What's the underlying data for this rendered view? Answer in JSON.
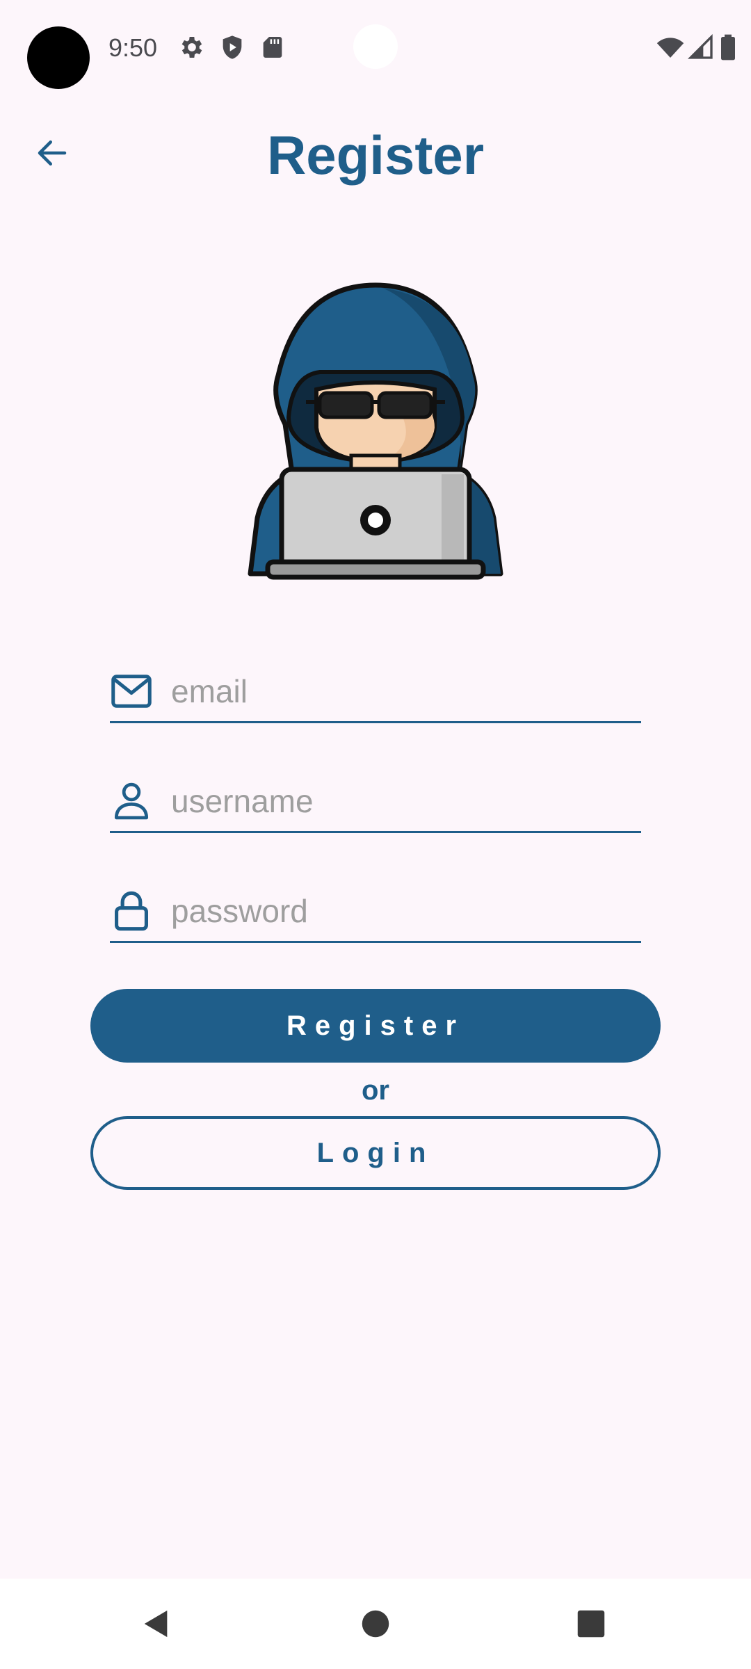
{
  "status_bar": {
    "time": "9:50",
    "left_icons": [
      "gear-icon",
      "shield-play-icon",
      "sd-card-icon"
    ],
    "right_icons": [
      "wifi-icon",
      "cellular-signal-icon",
      "battery-icon"
    ]
  },
  "header": {
    "title": "Register",
    "back_icon": "arrow-left-icon"
  },
  "illustration": "hooded-hacker-laptop",
  "form": {
    "email": {
      "placeholder": "email",
      "value": "",
      "icon": "mail-icon"
    },
    "username": {
      "placeholder": "username",
      "value": "",
      "icon": "person-icon"
    },
    "password": {
      "placeholder": "password",
      "value": "",
      "icon": "lock-icon"
    }
  },
  "actions": {
    "register_label": "Register",
    "or_label": "or",
    "login_label": "Login"
  },
  "nav": [
    "back-triangle-icon",
    "home-circle-icon",
    "recents-square-icon"
  ],
  "colors": {
    "primary": "#1f5e8a",
    "background": "#fdf6fb",
    "placeholder": "#9e9e9e"
  }
}
